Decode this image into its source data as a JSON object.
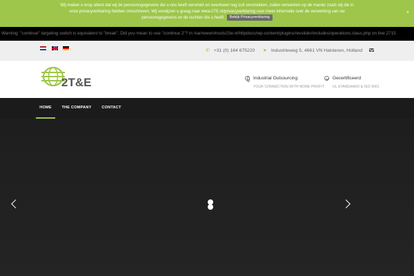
{
  "cookie_bar": {
    "message": "Wij maken u erop attent dat wij de persoonsgegevens die u ons heeft verstrekt en eventueel nog zult verstrekken, zullen verwerken op de manier zoals wij die in onze privacyverklaring hebben omschreven. Wij verwijzen u graag naar www.2TE.nl/privacyverklaring voor meer informatie over de verwerking van uw persoonsgegevens en de rechten die u heeft.",
    "button_label": "Bekijk Privacyverklaring",
    "close_glyph": "×"
  },
  "warning": {
    "text": "Warning: \"continue\" targeting switch is equivalent to \"break\". Did you mean to use \"continue 2\"? in /var/www/vhosts/2te.nl/httpdocs/wp-content/plugins/revslider/includes/operations.class.php on line 2715"
  },
  "top_bar": {
    "languages": [
      "nl",
      "en",
      "de"
    ],
    "phone": "+31 (0) 164 675220",
    "address": "Industrieweg 5, 4661 VN Halsteren, Holland",
    "phone_icon": "phone-icon",
    "address_icon": "location-arrow-icon",
    "mail_icon": "envelope-icon"
  },
  "header": {
    "logo_text": "2T&E",
    "info": [
      {
        "title": "Industrial Outsourcing",
        "subtitle": "YOUR CONNECTION WITH MORE PROFIT",
        "icon": "globe-icon"
      },
      {
        "title": "Gecertificeerd",
        "subtitle": "UL STANDAARD & ISO 9001",
        "icon": "check-circle-icon"
      }
    ]
  },
  "nav": {
    "items": [
      "HOME",
      "THE COMPANY",
      "CONTACT"
    ],
    "active": "HOME"
  },
  "slider": {
    "prev_icon": "chevron-left-icon",
    "next_icon": "chevron-right-icon"
  },
  "colors": {
    "accent": "#9ec64a",
    "dark": "#1b1b1b",
    "topbar": "#efefef",
    "cookie_button": "#6a6a6a"
  }
}
